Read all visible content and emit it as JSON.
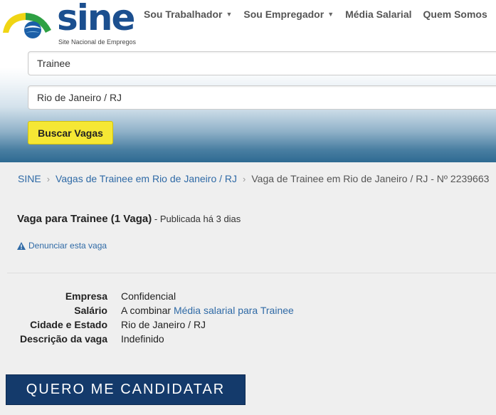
{
  "logo": {
    "text": "sine",
    "subtitle": "Site Nacional de Empregos"
  },
  "nav": [
    {
      "label": "Sou Trabalhador",
      "caret": true
    },
    {
      "label": "Sou Empregador",
      "caret": true
    },
    {
      "label": "Média Salarial",
      "caret": false
    },
    {
      "label": "Quem Somos",
      "caret": false
    }
  ],
  "search": {
    "job_value": "Trainee",
    "location_value": "Rio de Janeiro / RJ",
    "button_label": "Buscar Vagas"
  },
  "breadcrumb": {
    "home": "SINE",
    "category": "Vagas de Trainee em Rio de Janeiro / RJ",
    "current": "Vaga de Trainee em Rio de Janeiro / RJ - Nº 2239663"
  },
  "job": {
    "title": "Vaga para Trainee (1 Vaga)",
    "published": " - Publicada há 3 dias",
    "report_label": "Denunciar esta vaga"
  },
  "details": {
    "company_label": "Empresa",
    "company_value": "Confidencial",
    "salary_label": "Salário",
    "salary_value": "A combinar ",
    "salary_link": "Média salarial para Trainee",
    "city_label": "Cidade e Estado",
    "city_value": "Rio de Janeiro / RJ",
    "desc_label": "Descrição da vaga",
    "desc_value": "Indefinido"
  },
  "apply_label": "QUERO ME CANDIDATAR",
  "colors": {
    "brand_blue": "#1b4f8f",
    "link": "#2f6aa6",
    "search_button": "#f5e734",
    "apply_button": "#143a6b"
  },
  "icons": {
    "report": "warning-triangle-icon",
    "nav_caret": "caret-down-icon"
  }
}
